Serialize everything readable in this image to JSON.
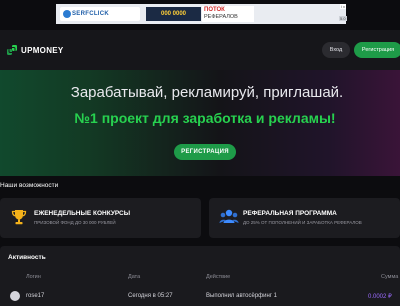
{
  "banner": {
    "logo_text": "SERFCLICK",
    "counter_text": "000 0000",
    "promo_title": "ПОТОК",
    "promo_sub": "РЕФЕРАЛОВ",
    "ad_mark": "i x",
    "badge": "5.0"
  },
  "header": {
    "logo": "UPMONEY",
    "login_label": "Вход",
    "register_label": "Регистрация"
  },
  "hero": {
    "title": "Зарабатывай, рекламируй, приглашай.",
    "subtitle": "№1 проект для заработка и рекламы!",
    "button_label": "РЕГИСТРАЦИЯ"
  },
  "features": {
    "section_title": "Наши возможности",
    "items": [
      {
        "title": "ЕЖЕНЕДЕЛЬНЫЕ КОНКУРСЫ",
        "desc": "ПРИЗОВОЙ ФОНД ДО 30 000 РУБЛЕЙ",
        "icon": "trophy-icon"
      },
      {
        "title": "РЕФЕРАЛЬНАЯ ПРОГРАММА",
        "desc": "ДО 25% ОТ ПОПОЛНЕНИЙ И ЗАРАБОТКА РЕФЕРАЛОВ",
        "icon": "users-icon"
      }
    ]
  },
  "activity": {
    "title": "Активность",
    "columns": {
      "login": "Логин",
      "date": "Дата",
      "action": "Действие",
      "amount": "Сумма"
    },
    "rows": [
      {
        "login": "rose17",
        "date": "Сегодня в 05:27",
        "action": "Выполнил автосёрфинг 1",
        "amount": "0.0002 ₽"
      }
    ]
  },
  "colors": {
    "accent_green": "#1e9b48",
    "headline_green": "#27d14f",
    "amount_purple": "#9b6bff",
    "background": "#0c0c0f"
  }
}
